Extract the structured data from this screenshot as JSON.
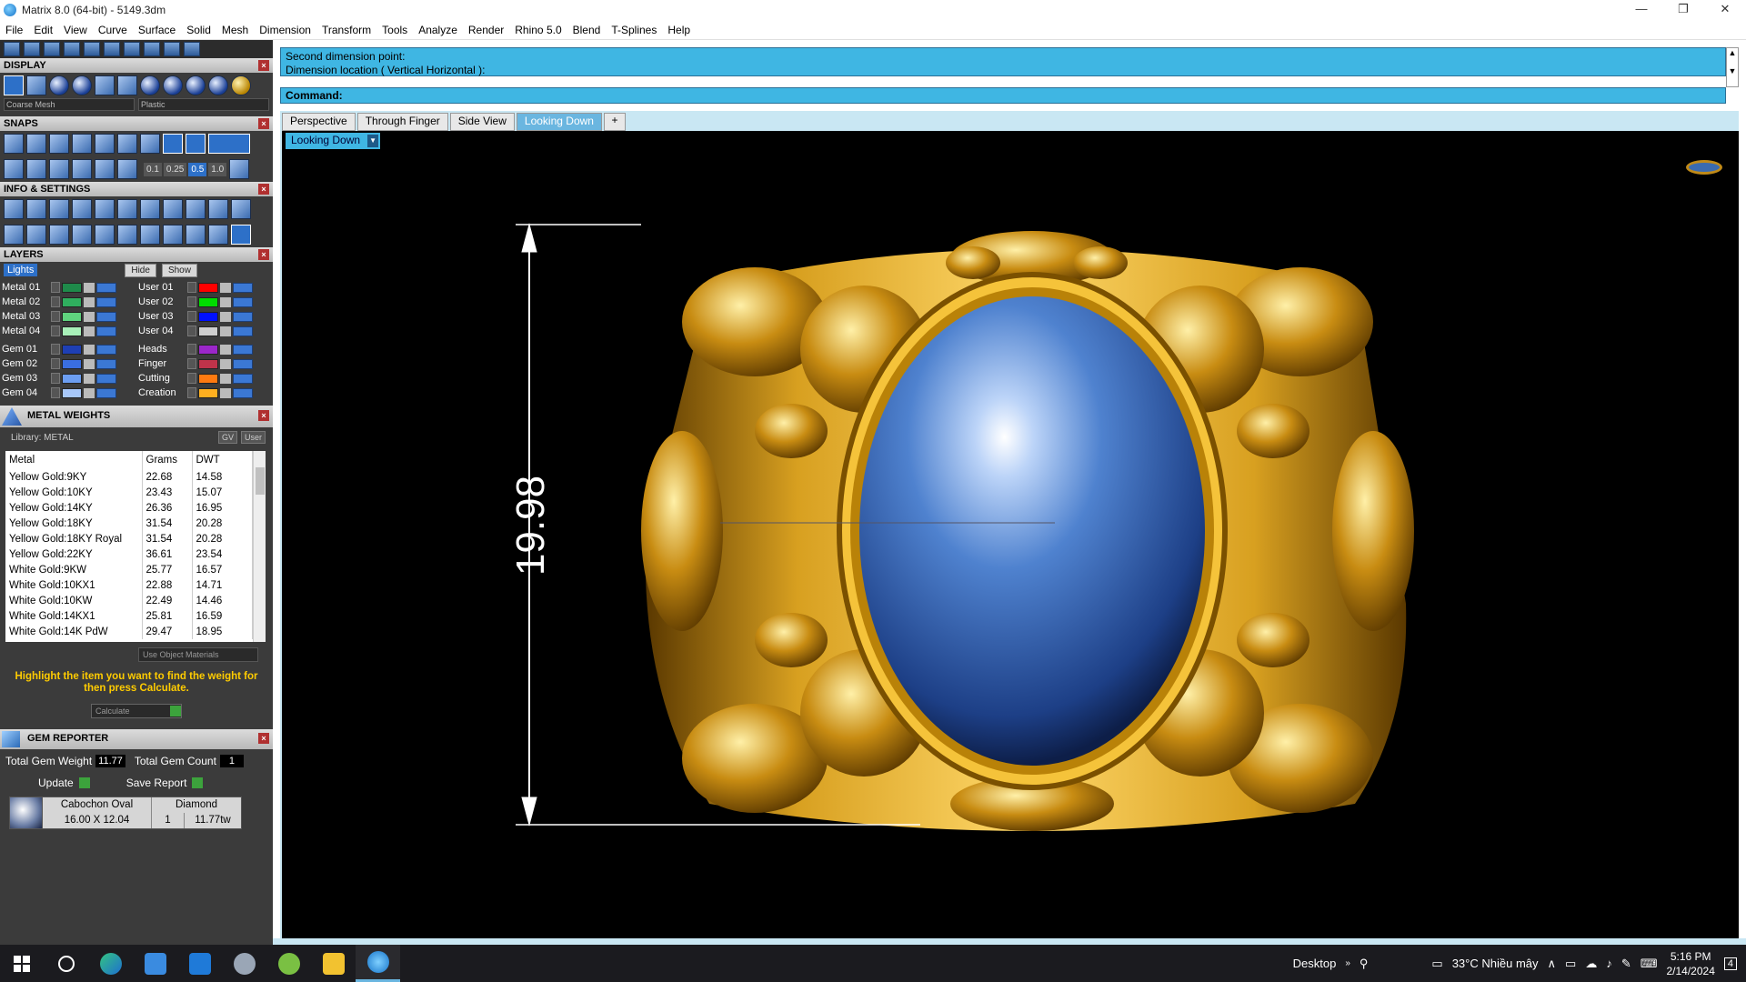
{
  "window": {
    "title": "Matrix 8.0 (64-bit) - 5149.3dm",
    "controls": [
      "—",
      "❐",
      "✕"
    ]
  },
  "menu": [
    "File",
    "Edit",
    "View",
    "Curve",
    "Surface",
    "Solid",
    "Mesh",
    "Dimension",
    "Transform",
    "Tools",
    "Analyze",
    "Render",
    "Rhino 5.0",
    "Blend",
    "T-Splines",
    "Help"
  ],
  "display": {
    "header": "DISPLAY",
    "mesh_select": "Coarse Mesh",
    "material_select": "Plastic"
  },
  "snaps": {
    "header": "SNAPS",
    "values": [
      "0.1",
      "0.25",
      "0.5",
      "1.0"
    ]
  },
  "info": {
    "header": "INFO & SETTINGS"
  },
  "layers": {
    "header": "LAYERS",
    "lights_label": "Lights",
    "hide_label": "Hide",
    "show_label": "Show",
    "left": [
      {
        "name": "Metal 01",
        "color": "#1e8a4a"
      },
      {
        "name": "Metal 02",
        "color": "#2fae5e"
      },
      {
        "name": "Metal 03",
        "color": "#5fd37e"
      },
      {
        "name": "Metal 04",
        "color": "#a8f0b8"
      },
      {
        "name": "Gem 01",
        "color": "#1e3fb4"
      },
      {
        "name": "Gem 02",
        "color": "#3a6ee0"
      },
      {
        "name": "Gem 03",
        "color": "#6c9ef2"
      },
      {
        "name": "Gem 04",
        "color": "#a8c8fa"
      }
    ],
    "right": [
      {
        "name": "User 01",
        "color": "#ff0000"
      },
      {
        "name": "User 02",
        "color": "#00dd00"
      },
      {
        "name": "User 03",
        "color": "#0010ff"
      },
      {
        "name": "User 04",
        "color": "#cfcfcf"
      },
      {
        "name": "Heads",
        "color": "#9b27c9"
      },
      {
        "name": "Finger",
        "color": "#c0334a"
      },
      {
        "name": "Cutting",
        "color": "#ff7a10"
      },
      {
        "name": "Creation",
        "color": "#ffb020"
      }
    ]
  },
  "metal_weights": {
    "header": "METAL WEIGHTS",
    "library_label": "Library: METAL",
    "toggle_gv": "GV",
    "toggle_user": "User",
    "columns": [
      "Metal",
      "Grams",
      "DWT"
    ],
    "rows": [
      [
        "Yellow Gold:9KY",
        "22.68",
        "14.58"
      ],
      [
        "Yellow Gold:10KY",
        "23.43",
        "15.07"
      ],
      [
        "Yellow Gold:14KY",
        "26.36",
        "16.95"
      ],
      [
        "Yellow Gold:18KY",
        "31.54",
        "20.28"
      ],
      [
        "Yellow Gold:18KY Royal",
        "31.54",
        "20.28"
      ],
      [
        "Yellow Gold:22KY",
        "36.61",
        "23.54"
      ],
      [
        "White Gold:9KW",
        "25.77",
        "16.57"
      ],
      [
        "White Gold:10KX1",
        "22.88",
        "14.71"
      ],
      [
        "White Gold:10KW",
        "22.49",
        "14.46"
      ],
      [
        "White Gold:14KX1",
        "25.81",
        "16.59"
      ],
      [
        "White Gold:14K PdW",
        "29.47",
        "18.95"
      ]
    ],
    "use_object_materials": "Use Object Materials",
    "hint": "Highlight the item you want to find the weight for then press Calculate.",
    "calculate": "Calculate"
  },
  "gem_reporter": {
    "header": "GEM REPORTER",
    "total_weight_label": "Total Gem Weight",
    "total_weight_value": "11.77",
    "total_count_label": "Total Gem Count",
    "total_count_value": "1",
    "update_label": "Update",
    "save_report_label": "Save Report",
    "gem": {
      "cut": "Cabochon Oval",
      "material": "Diamond",
      "size": "16.00 X 12.04",
      "count": "1",
      "weight": "11.77tw"
    }
  },
  "command": {
    "line1": "Second dimension point:",
    "line2": "Dimension location ( Vertical  Horizontal ):",
    "prompt": "Command:"
  },
  "tabs": [
    "Perspective",
    "Through Finger",
    "Side View",
    "Looking Down"
  ],
  "active_tab": "Looking Down",
  "viewport": {
    "label": "Looking Down",
    "dimension_value": "19.98"
  },
  "taskbar": {
    "desktop_label": "Desktop",
    "weather": "33°C  Nhiều mây",
    "time": "5:16 PM",
    "date": "2/14/2024",
    "notifications": "4"
  }
}
